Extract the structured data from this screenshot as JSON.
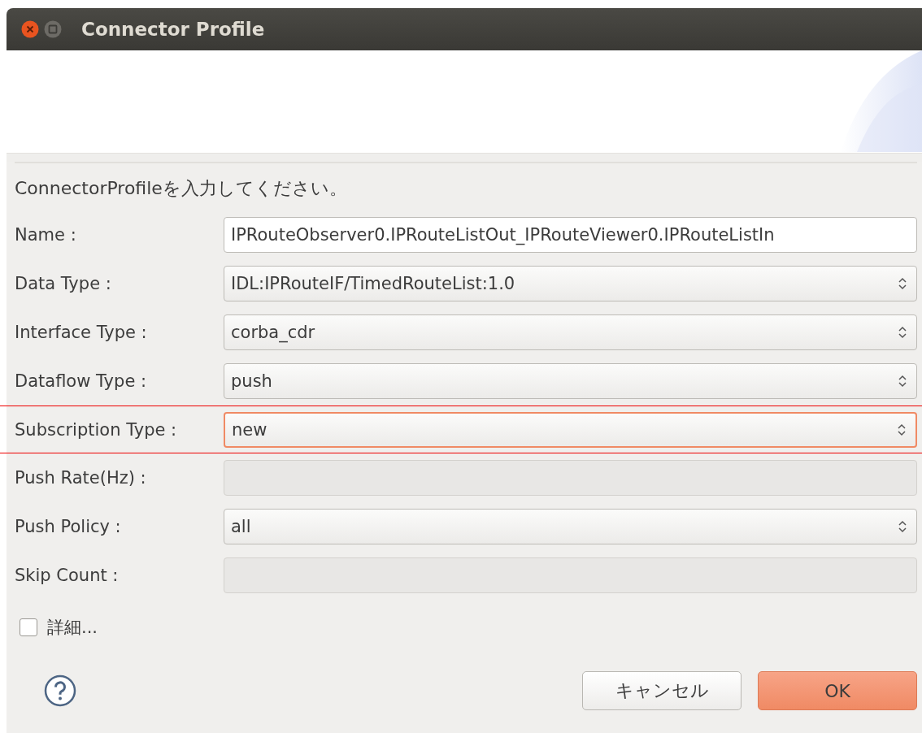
{
  "window": {
    "title": "Connector Profile"
  },
  "instruction": "ConnectorProfileを入力してください。",
  "fields": [
    {
      "label": "Name :",
      "kind": "text",
      "value": "IPRouteObserver0.IPRouteListOut_IPRouteViewer0.IPRouteListIn",
      "disabled": false,
      "focused": false,
      "highlighted": false
    },
    {
      "label": "Data Type :",
      "kind": "select",
      "value": "IDL:IPRouteIF/TimedRouteList:1.0",
      "disabled": false,
      "focused": false,
      "highlighted": false
    },
    {
      "label": "Interface Type :",
      "kind": "select",
      "value": "corba_cdr",
      "disabled": false,
      "focused": false,
      "highlighted": false
    },
    {
      "label": "Dataflow Type :",
      "kind": "select",
      "value": "push",
      "disabled": false,
      "focused": false,
      "highlighted": false
    },
    {
      "label": "Subscription Type :",
      "kind": "select",
      "value": "new",
      "disabled": false,
      "focused": true,
      "highlighted": true
    },
    {
      "label": "Push Rate(Hz) :",
      "kind": "text",
      "disabled": true,
      "focused": false,
      "highlighted": false
    },
    {
      "label": "Push Policy :",
      "kind": "select",
      "value": "all",
      "disabled": false,
      "focused": false,
      "highlighted": false
    },
    {
      "label": "Skip Count :",
      "kind": "text",
      "disabled": true,
      "focused": false,
      "highlighted": false
    }
  ],
  "details": {
    "label": "詳細...",
    "checked": false
  },
  "buttons": [
    {
      "label": "キャンセル",
      "kind": "normal"
    },
    {
      "label": "OK",
      "kind": "default"
    }
  ]
}
